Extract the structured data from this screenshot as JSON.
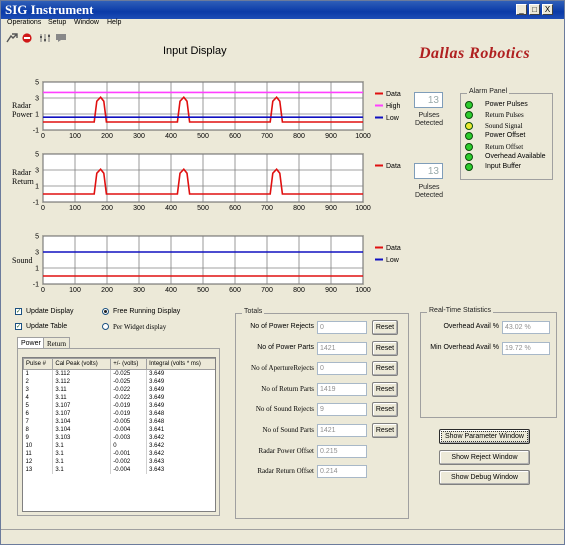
{
  "window": {
    "title": "SIG Instrument",
    "minimize": "_",
    "maximize": "□",
    "close": "X"
  },
  "menu": [
    "Operations",
    "Setup",
    "Window",
    "Help"
  ],
  "heading": "Input Display",
  "logo": "Dallas Robotics",
  "charts": {
    "radar_power": {
      "label_line1": "Radar",
      "label_line2": "Power"
    },
    "radar_return": {
      "label_line1": "Radar",
      "label_line2": "Return"
    },
    "sound": {
      "label_line1": "Sound"
    }
  },
  "chart_data": [
    {
      "type": "line",
      "name": "Radar Power",
      "x_ticks": [
        "0",
        "100",
        "200",
        "300",
        "400",
        "500",
        "600",
        "700",
        "800",
        "900",
        "1000"
      ],
      "y_ticks": [
        "5",
        "3",
        "1",
        "-1"
      ],
      "xlim": [
        0,
        1000
      ],
      "ylim": [
        -1,
        5
      ],
      "grid": true,
      "legend": [
        "Data",
        "High",
        "Low"
      ],
      "series": [
        {
          "name": "Data",
          "color": "#e01010",
          "x": [
            0,
            160,
            168,
            180,
            190,
            198,
            420,
            428,
            440,
            450,
            458,
            710,
            718,
            730,
            740,
            748,
            1000
          ],
          "y": [
            0,
            0,
            2.6,
            3.1,
            2.6,
            0,
            0,
            2.6,
            3.1,
            2.6,
            0,
            0,
            2.6,
            3.1,
            2.6,
            0,
            0
          ]
        },
        {
          "name": "High",
          "color": "#ff40ff",
          "x": [
            0,
            1000
          ],
          "y": [
            3.7,
            3.7
          ]
        },
        {
          "name": "Low",
          "color": "#1010c0",
          "x": [
            0,
            1000
          ],
          "y": [
            0.6,
            0.6
          ]
        }
      ]
    },
    {
      "type": "line",
      "name": "Radar Return",
      "x_ticks": [
        "0",
        "100",
        "200",
        "300",
        "400",
        "500",
        "600",
        "700",
        "800",
        "900",
        "1000"
      ],
      "y_ticks": [
        "5",
        "3",
        "1",
        "-1"
      ],
      "xlim": [
        0,
        1000
      ],
      "ylim": [
        -1,
        5
      ],
      "grid": true,
      "legend": [
        "Data"
      ],
      "series": [
        {
          "name": "Data",
          "color": "#e01010",
          "x": [
            0,
            160,
            168,
            180,
            190,
            198,
            420,
            428,
            440,
            450,
            458,
            710,
            718,
            730,
            740,
            748,
            1000
          ],
          "y": [
            0,
            0,
            2.6,
            3.1,
            2.6,
            0,
            0,
            2.6,
            3.1,
            2.6,
            0,
            0,
            2.6,
            3.1,
            2.6,
            0,
            0
          ]
        }
      ]
    },
    {
      "type": "line",
      "name": "Sound",
      "x_ticks": [
        "0",
        "100",
        "200",
        "300",
        "400",
        "500",
        "600",
        "700",
        "800",
        "900",
        "1000"
      ],
      "y_ticks": [
        "5",
        "3",
        "1",
        "-1"
      ],
      "xlim": [
        0,
        1000
      ],
      "ylim": [
        -1,
        5
      ],
      "grid": true,
      "legend": [
        "Data",
        "Low"
      ],
      "series": [
        {
          "name": "Data",
          "color": "#e01010",
          "x": [
            0,
            1000
          ],
          "y": [
            0,
            0
          ]
        },
        {
          "name": "Low",
          "color": "#1010c0",
          "x": [
            0,
            1000
          ],
          "y": [
            3,
            3
          ]
        }
      ]
    }
  ],
  "pulses_power": {
    "value": "13",
    "label1": "Pulses",
    "label2": "Detected"
  },
  "pulses_return": {
    "value": "13",
    "label1": "Pulses",
    "label2": "Detected"
  },
  "alarm_panel": {
    "title": "Alarm Panel",
    "items": [
      {
        "label": "Power Pulses",
        "color": "#2dcc2d"
      },
      {
        "label": "Return Pulses",
        "color": "#2dcc2d"
      },
      {
        "label": "Sound  Signal",
        "color": "#e8e830"
      },
      {
        "label": "Power Offset",
        "color": "#2dcc2d"
      },
      {
        "label": "Return Offset",
        "color": "#2dcc2d"
      },
      {
        "label": "Overhead Available",
        "color": "#2dcc2d"
      },
      {
        "label": "Input Buffer",
        "color": "#2dcc2d"
      }
    ]
  },
  "options": {
    "update_display": "Update Display",
    "update_table": "Update Table",
    "free_running": "Free Running Display",
    "per_widget": "Per  Widget display"
  },
  "tabs": [
    "Power",
    "Return"
  ],
  "table": {
    "headers": [
      "Pulse #",
      "Cal Peak (volts)",
      "+/- (volts)",
      "Integral (volts * ms)"
    ],
    "rows": [
      [
        "1",
        "3.112",
        "-0.025",
        "3.649"
      ],
      [
        "2",
        "3.112",
        "-0.025",
        "3.649"
      ],
      [
        "3",
        "3.11",
        "-0.022",
        "3.649"
      ],
      [
        "4",
        "3.11",
        "-0.022",
        "3.649"
      ],
      [
        "5",
        "3.107",
        "-0.019",
        "3.649"
      ],
      [
        "6",
        "3.107",
        "-0.019",
        "3.648"
      ],
      [
        "7",
        "3.104",
        "-0.005",
        "3.648"
      ],
      [
        "8",
        "3.104",
        "-0.004",
        "3.641"
      ],
      [
        "9",
        "3.103",
        "-0.003",
        "3.642"
      ],
      [
        "10",
        "3.1",
        "0",
        "3.642"
      ],
      [
        "11",
        "3.1",
        "-0.001",
        "3.642"
      ],
      [
        "12",
        "3.1",
        "-0.002",
        "3.643"
      ],
      [
        "13",
        "3.1",
        "-0.004",
        "3.643"
      ]
    ]
  },
  "totals": {
    "title": "Totals",
    "rows": [
      {
        "label": "No of Power Rejects",
        "value": "0",
        "button": "Reset"
      },
      {
        "label": "No of Power Parts",
        "value": "1421",
        "button": "Reset"
      },
      {
        "label": "No of ApertureRejects",
        "value": "0",
        "button": "Reset"
      },
      {
        "label": "No of Return Parts",
        "value": "1419",
        "button": "Reset"
      },
      {
        "label": "No of Sound Rejects",
        "value": "9",
        "button": "Reset"
      },
      {
        "label": "No of Sound Parts",
        "value": "1421",
        "button": "Reset"
      },
      {
        "label": "Radar  Power Offset",
        "value": "0.215"
      },
      {
        "label": "Radar Return Offset",
        "value": "0.214"
      }
    ]
  },
  "realtime": {
    "title": "Real-Time Statistics",
    "overhead_label": "Overhead Avail %",
    "overhead_value": "43.02 %",
    "min_overhead_label": "Min Overhead Avail %",
    "min_overhead_value": "19.72 %"
  },
  "buttons": {
    "parameter": "Show Parameter Window",
    "reject": "Show Reject Window",
    "debug": "Show Debug Window"
  }
}
